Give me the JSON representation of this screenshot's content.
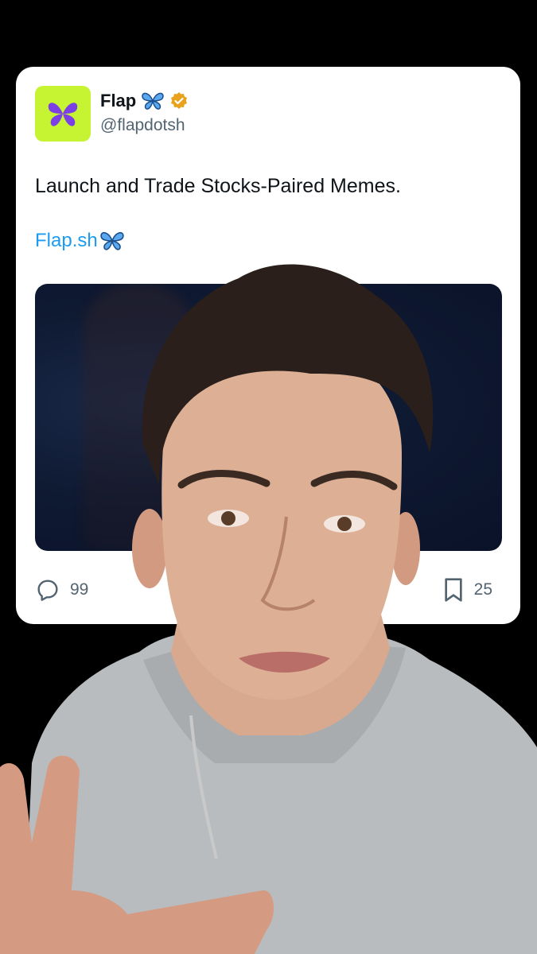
{
  "post": {
    "display_name": "Flap",
    "name_emoji": "🦋",
    "verified_badge_icon": "verified-badge-icon",
    "handle": "@flapdotsh",
    "text": "Launch and Trade Stocks-Paired Memes.",
    "link_text": "Flap.sh",
    "link_emoji": "🦋",
    "reply_count": "99",
    "bookmark_count": "25"
  },
  "colors": {
    "avatar_bg": "#c6f432",
    "avatar_logo": "#7b3fe4",
    "link": "#1d9bf0",
    "badge": "#e8a21b"
  },
  "icons": [
    "flap-logo-icon",
    "butterfly-icon",
    "verified-badge-icon",
    "reply-icon",
    "bookmark-icon"
  ]
}
